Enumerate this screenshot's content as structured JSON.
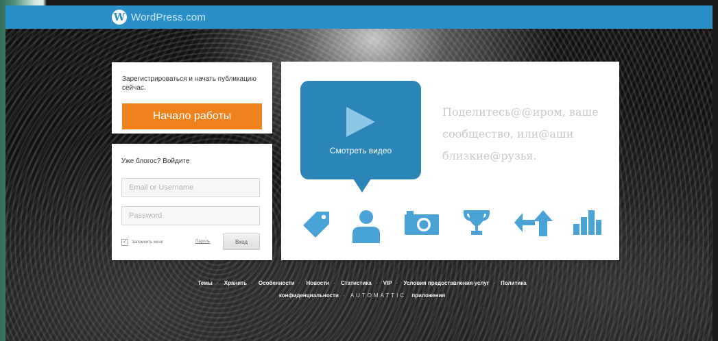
{
  "header": {
    "brand": "WordPress.com",
    "logo_letter": "W"
  },
  "signup": {
    "text": "Зарегистрироваться и начать публикацию сейчас.",
    "button": "Начало работы"
  },
  "login": {
    "title": "Уже блогос? Войдите",
    "username_placeholder": "Email or Username",
    "password_placeholder": "Password",
    "remember_label": "Запомнить меня",
    "remember_checked": "✓",
    "forgot_link": "Пароль",
    "submit": "Вход"
  },
  "video": {
    "button_label": "Смотреть видео",
    "tagline": "Поделитесь@@иром, ваше сообщество, или@аши близкие@рузья."
  },
  "features": {
    "icons": [
      "tag-icon",
      "user-icon",
      "camera-icon",
      "trophy-icon",
      "reblog-icon",
      "stats-icon"
    ]
  },
  "footer": {
    "links": [
      "Темы",
      "Хранить",
      "Особенности",
      "Новости",
      "Статистика",
      "VIP",
      "Условия предоставления услуг",
      "Политика"
    ],
    "line2_left": "конфиденциальности",
    "brand": "AUTOMATTIC",
    "line2_right": "приложения"
  },
  "colors": {
    "topbar": "#2a8fc6",
    "accent_orange": "#f0821e",
    "video_blue": "#2b86b7",
    "icon_blue": "#4aa3d6"
  }
}
